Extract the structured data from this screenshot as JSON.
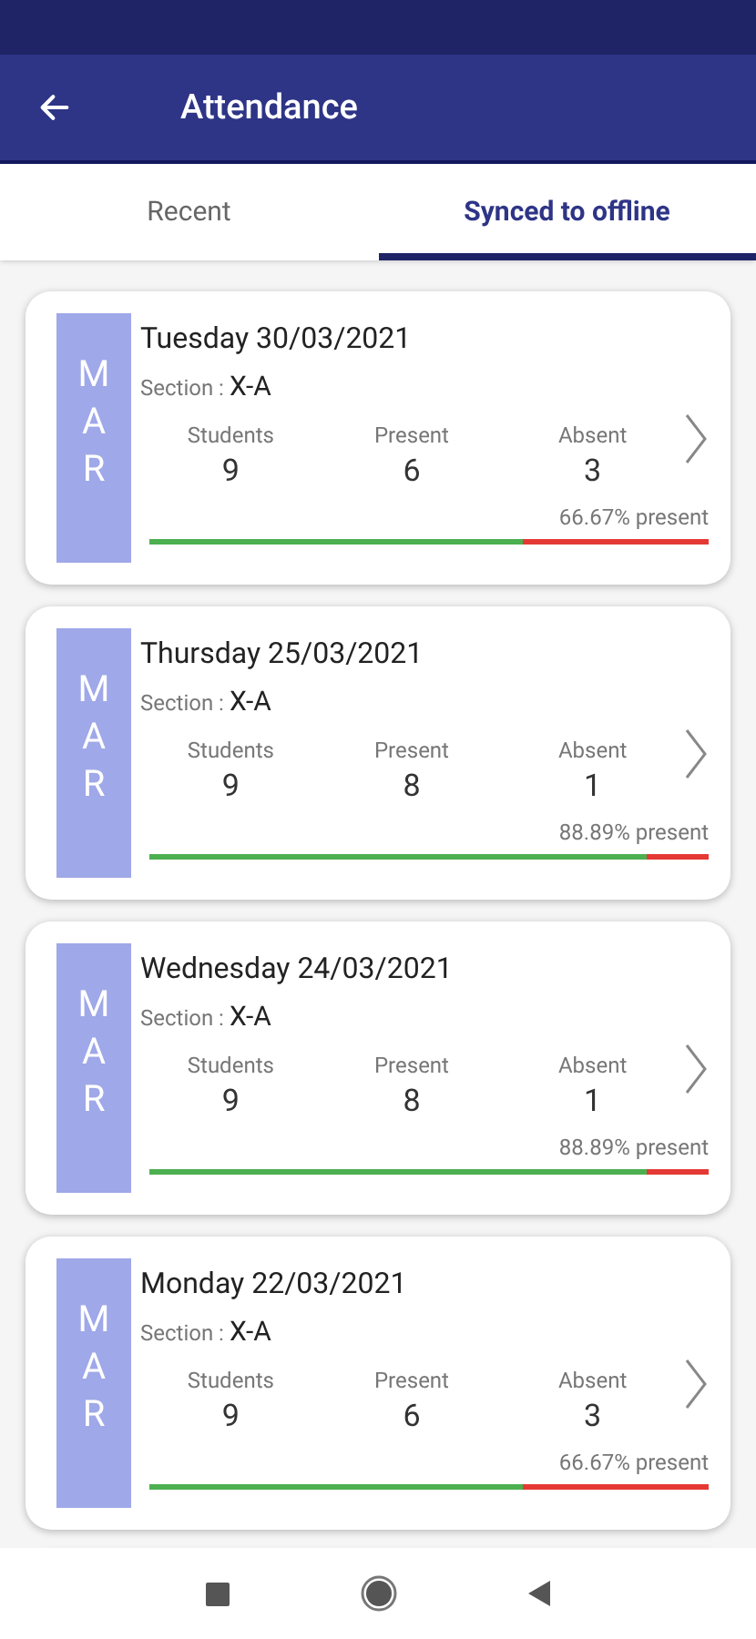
{
  "app_bar": {
    "title": "Attendance"
  },
  "tabs": [
    {
      "label": "Recent",
      "selected": false
    },
    {
      "label": "Synced to offline",
      "selected": true
    }
  ],
  "records": [
    {
      "month": "MAR",
      "date": "Tuesday 30/03/2021",
      "section_label": "Section :",
      "section": "X-A",
      "stats": [
        {
          "label": "Students",
          "value": "9"
        },
        {
          "label": "Present",
          "value": "6"
        },
        {
          "label": "Absent",
          "value": "3"
        }
      ],
      "percent": "66.67% present",
      "level": 0.6667
    },
    {
      "month": "MAR",
      "date": "Thursday 25/03/2021",
      "section_label": "Section :",
      "section": "X-A",
      "stats": [
        {
          "label": "Students",
          "value": "9"
        },
        {
          "label": "Present",
          "value": "8"
        },
        {
          "label": "Absent",
          "value": "1"
        }
      ],
      "percent": "88.89% present",
      "level": 0.8889
    },
    {
      "month": "MAR",
      "date": "Wednesday 24/03/2021",
      "section_label": "Section :",
      "section": "X-A",
      "stats": [
        {
          "label": "Students",
          "value": "9"
        },
        {
          "label": "Present",
          "value": "8"
        },
        {
          "label": "Absent",
          "value": "1"
        }
      ],
      "percent": "88.89% present",
      "level": 0.8889
    },
    {
      "month": "MAR",
      "date": "Monday 22/03/2021",
      "section_label": "Section :",
      "section": "X-A",
      "stats": [
        {
          "label": "Students",
          "value": "9"
        },
        {
          "label": "Present",
          "value": "6"
        },
        {
          "label": "Absent",
          "value": "3"
        }
      ],
      "percent": "66.67% present",
      "level": 0.6667
    }
  ]
}
